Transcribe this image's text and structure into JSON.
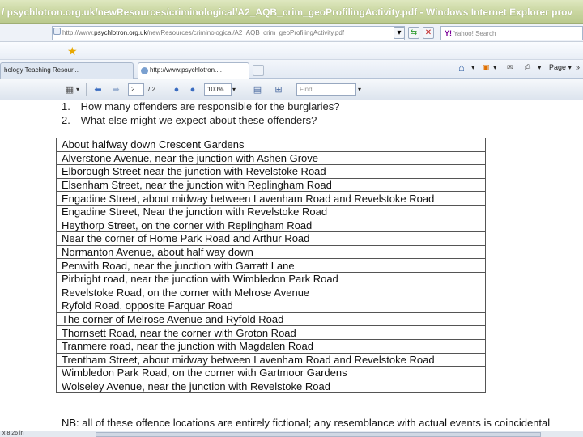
{
  "window": {
    "title": "/ psychlotron.org.uk/newResources/criminological/A2_AQB_crim_geoProfilingActivity.pdf - Windows Internet Explorer prov"
  },
  "address_bar": {
    "url_prefix": "http://www.",
    "url_domain": "psychlotron.org.uk",
    "url_path": "/newResources/criminological/A2_AQB_crim_geoProfilingActivity.pdf",
    "search_placeholder": "Yahoo! Search",
    "search_brand": "Y!"
  },
  "tabs": [
    {
      "label": "hology Teaching Resour..."
    },
    {
      "label": "http://www.psychlotron...."
    }
  ],
  "command_bar": {
    "page_label": "Page",
    "chevron": "»"
  },
  "pdf_toolbar": {
    "current_page": "2",
    "total_pages": "/ 2",
    "zoom": "100%",
    "find_placeholder": "Find"
  },
  "document": {
    "questions": [
      {
        "num": "1.",
        "text": "How many offenders are responsible for the burglaries?"
      },
      {
        "num": "2.",
        "text": "What else might we expect about these offenders?"
      }
    ],
    "locations": [
      "About halfway down Crescent Gardens",
      "Alverstone Avenue, near the junction with Ashen Grove",
      "Elborough Street near the junction with Revelstoke Road",
      "Elsenham Street, near the junction with Replingham Road",
      "Engadine Street, about midway between Lavenham Road and Revelstoke Road",
      "Engadine Street, Near the junction with Revelstoke Road",
      "Heythorp Street, on the corner with Replingham Road",
      "Near the corner of Home Park Road and Arthur Road",
      "Normanton Avenue, about half way down",
      "Penwith Road, near the junction with Garratt Lane",
      "Pirbright road, near the junction with Wimbledon Park Road",
      "Revelstoke Road, on the corner with Melrose Avenue",
      "Ryfold Road, opposite Farquar Road",
      "The corner of Melrose Avenue and Ryfold Road",
      "Thornsett Road, near the corner with Groton Road",
      "Tranmere road, near the junction with Magdalen Road",
      "Trentham Street, about midway between Lavenham Road and Revelstoke Road",
      "Wimbledon Park Road, on the corner with Gartmoor Gardens",
      "Wolseley Avenue, near the junction with Revelstoke Road"
    ],
    "note": "NB: all of these offence locations are entirely fictional; any resemblance with actual events is coincidental"
  },
  "status_bar": {
    "page_size": "x 8.26 in"
  }
}
